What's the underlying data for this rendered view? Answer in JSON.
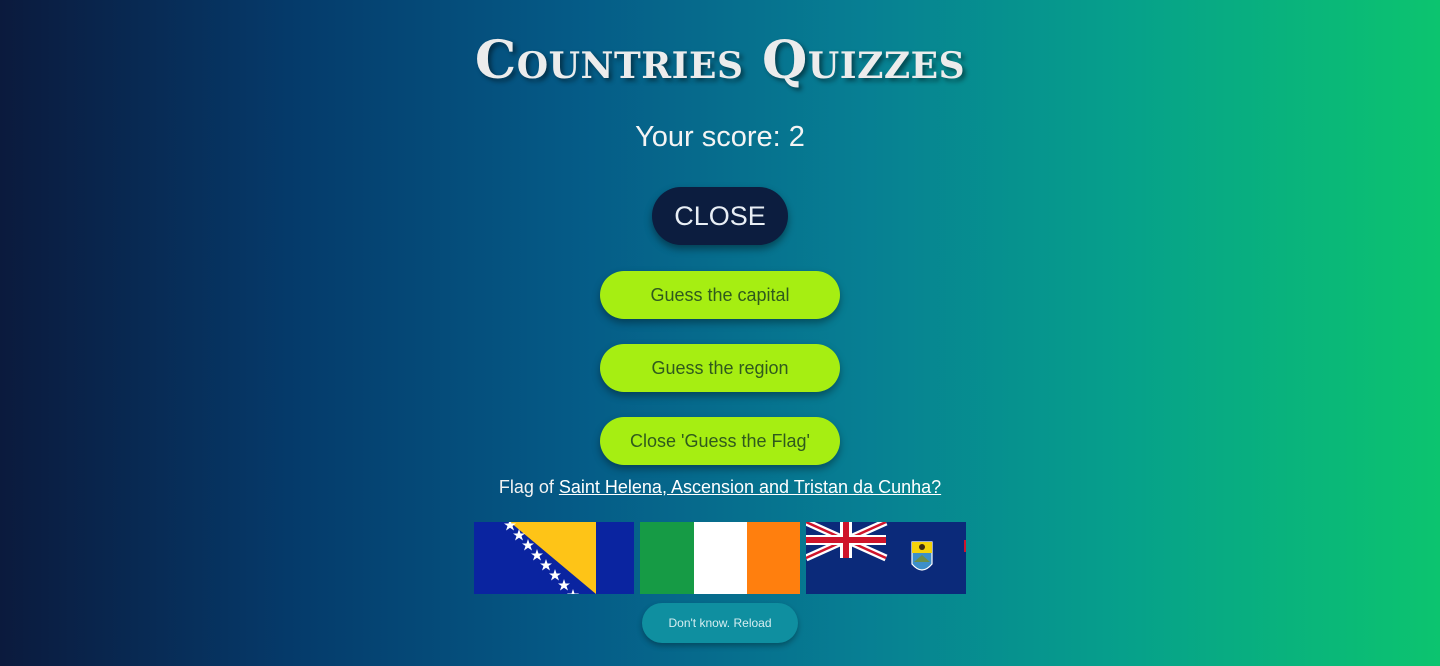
{
  "page": {
    "title": "Countries Quizzes",
    "score_text": "Your score: 2"
  },
  "buttons": {
    "close": "CLOSE",
    "guess_capital": "Guess the capital",
    "guess_region": "Guess the region",
    "close_guess_flag": "Close 'Guess the Flag'",
    "reload": "Don't know. Reload"
  },
  "question": {
    "prefix": "Flag of ",
    "country": "Saint Helena, Ascension and Tristan da Cunha?"
  },
  "flags": [
    {
      "icon": "bosnia-herzegovina-flag-icon"
    },
    {
      "icon": "ireland-flag-icon"
    },
    {
      "icon": "saint-helena-flag-icon"
    }
  ],
  "colors": {
    "lime": "#a6ee12",
    "close_bg": "#0c1d3f",
    "reload_bg": "#0f8fa0"
  }
}
